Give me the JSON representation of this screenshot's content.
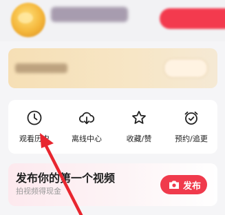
{
  "quick_actions": [
    {
      "label": "观看历史",
      "icon": "clock-icon"
    },
    {
      "label": "离线中心",
      "icon": "cloud-download-icon"
    },
    {
      "label": "收藏/赞",
      "icon": "star-icon"
    },
    {
      "label": "预约/追更",
      "icon": "alarm-clock-icon"
    }
  ],
  "publish_card": {
    "title": "发布你的第一个视频",
    "subtitle": "拍视频得现金",
    "button_label": "发布",
    "button_icon": "camera-icon"
  },
  "colors": {
    "accent_red": "#f03a4c",
    "annotation_arrow": "#e8262f"
  }
}
